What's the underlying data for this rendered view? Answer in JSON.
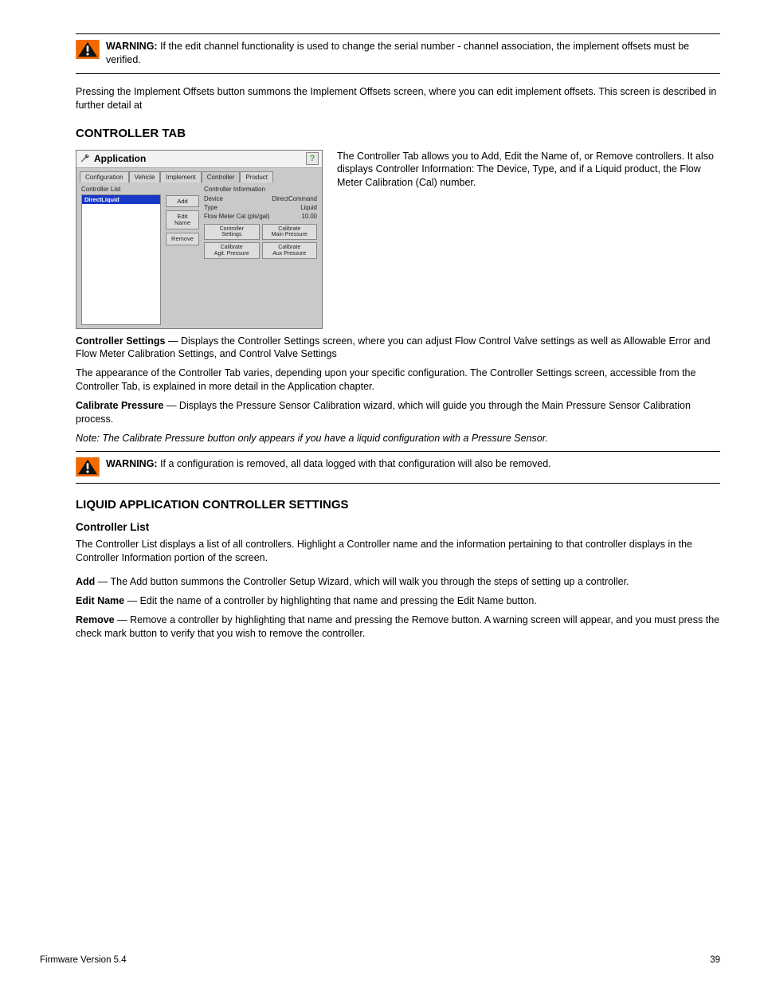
{
  "warnings": {
    "w1": {
      "lead": "WARNING:",
      "text": "If the edit channel functionality is used to change the serial number - channel association, the implement offsets must be verified."
    },
    "w2": {
      "lead": "WARNING:",
      "text": "If a configuration is removed, all data logged with that configuration will also be removed."
    }
  },
  "paras": {
    "p1": "Pressing the Implement Offsets button summons the Implement Offsets screen, where you can edit implement offsets. This screen is described in further detail at"
  },
  "headings": {
    "controller_tab": "CONTROLLER TAB",
    "liquid_ctrl_settings": "LIQUID APPLICATION CONTROLLER SETTINGS",
    "ctrl_list": "Controller List"
  },
  "two_col_text": "The Controller Tab allows you to Add, Edit the Name of, or Remove controllers. It also displays Controller Information: The Device, Type, and if a Liquid product, the Flow Meter Calibration (Cal) number.",
  "terms": {
    "t1": {
      "b": "Controller Settings",
      "rest": " — Displays the Controller Settings screen, where you can adjust Flow Control Valve settings as well as Allowable Error and Flow Meter Calibration Settings, and Control Valve Settings"
    },
    "t2p1": "The appearance of the Controller Tab varies, depending upon your specific configuration. The Controller Settings screen, accessible from the Controller Tab, is explained in more detail in the Application chapter.",
    "t3": {
      "b": "Calibrate Pressure",
      "rest": " — Displays the Pressure Sensor Calibration wizard, which will guide you through the Main Pressure Sensor Calibration process."
    },
    "note": {
      "i": "Note: The Calibrate Pressure button only appears if you have a liquid configuration with a Pressure Sensor."
    }
  },
  "below": {
    "p1": "The Controller List displays a list of all controllers. Highlight a Controller name and the information pertaining to that controller displays in the Controller Information portion of the screen.",
    "add": {
      "b": "Add",
      "rest": " — The Add button summons the Controller Setup Wizard, which will walk you through the steps of setting up a controller."
    },
    "editname": {
      "b": "Edit Name",
      "rest": " — Edit the name of a controller by highlighting that name and pressing the Edit Name button."
    },
    "remove": {
      "b": "Remove",
      "rest": " — Remove a controller by highlighting that name and pressing the Remove button. A warning screen will appear, and you must press the check mark button to verify that you wish to remove the controller."
    }
  },
  "footer": {
    "left": "Firmware Version 5.4",
    "right": "39"
  },
  "app": {
    "title": "Application",
    "tabs": [
      "Configuration",
      "Vehicle",
      "Implement",
      "Controller",
      "Product"
    ],
    "help": "?",
    "controller_list_label": "Controller List",
    "selected": "DirectLiquid",
    "buttons": {
      "add": "Add",
      "editname": "Edit\nName",
      "remove": "Remove"
    },
    "info_title": "Controller Information",
    "info": {
      "device_l": "Device",
      "device_v": "DirectCommand",
      "type_l": "Type",
      "type_v": "Liquid",
      "flow_l": "Flow Meter Cal (pls/gal)",
      "flow_v": "10.00"
    },
    "bgrid": {
      "b1": "Controller\nSettings",
      "b2": "Calibrate\nMain Pressure",
      "b3": "Calibrate\nAgit. Pressure",
      "b4": "Calibrate\nAux Pressure"
    }
  }
}
